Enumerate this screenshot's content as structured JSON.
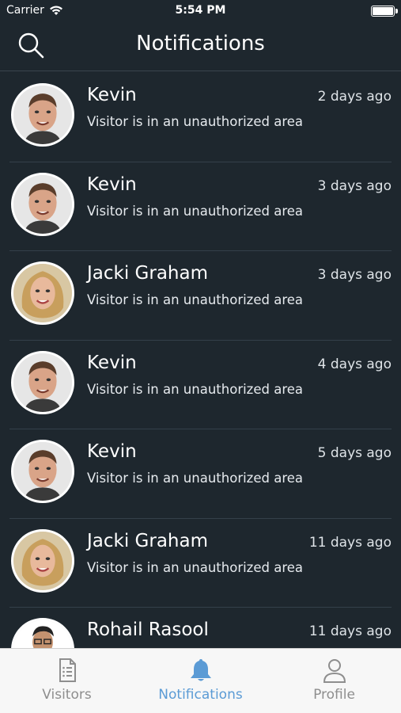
{
  "status_bar": {
    "carrier": "Carrier",
    "time": "5:54 PM"
  },
  "header": {
    "title": "Notifications"
  },
  "notifications": [
    {
      "name": "Kevin",
      "time": "2 days ago",
      "message": "Visitor is in an unauthorized area",
      "avatar": "male"
    },
    {
      "name": "Kevin",
      "time": "3 days ago",
      "message": "Visitor is in an unauthorized area",
      "avatar": "male"
    },
    {
      "name": "Jacki Graham",
      "time": "3 days ago",
      "message": "Visitor is in an unauthorized area",
      "avatar": "female"
    },
    {
      "name": "Kevin",
      "time": "4 days ago",
      "message": "Visitor is in an unauthorized area",
      "avatar": "male"
    },
    {
      "name": "Kevin",
      "time": "5 days ago",
      "message": "Visitor is in an unauthorized area",
      "avatar": "male"
    },
    {
      "name": "Jacki Graham",
      "time": "11 days ago",
      "message": "Visitor is in an unauthorized area",
      "avatar": "female"
    },
    {
      "name": "Rohail Rasool",
      "time": "11 days ago",
      "message": "",
      "avatar": "male-dark"
    }
  ],
  "tabs": [
    {
      "label": "Visitors",
      "icon": "document-list-icon",
      "active": false
    },
    {
      "label": "Notifications",
      "icon": "bell-icon",
      "active": true
    },
    {
      "label": "Profile",
      "icon": "person-icon",
      "active": false
    }
  ],
  "colors": {
    "background": "#1e272e",
    "accent": "#5b9bd5",
    "tab_inactive": "#8e8e8e"
  }
}
